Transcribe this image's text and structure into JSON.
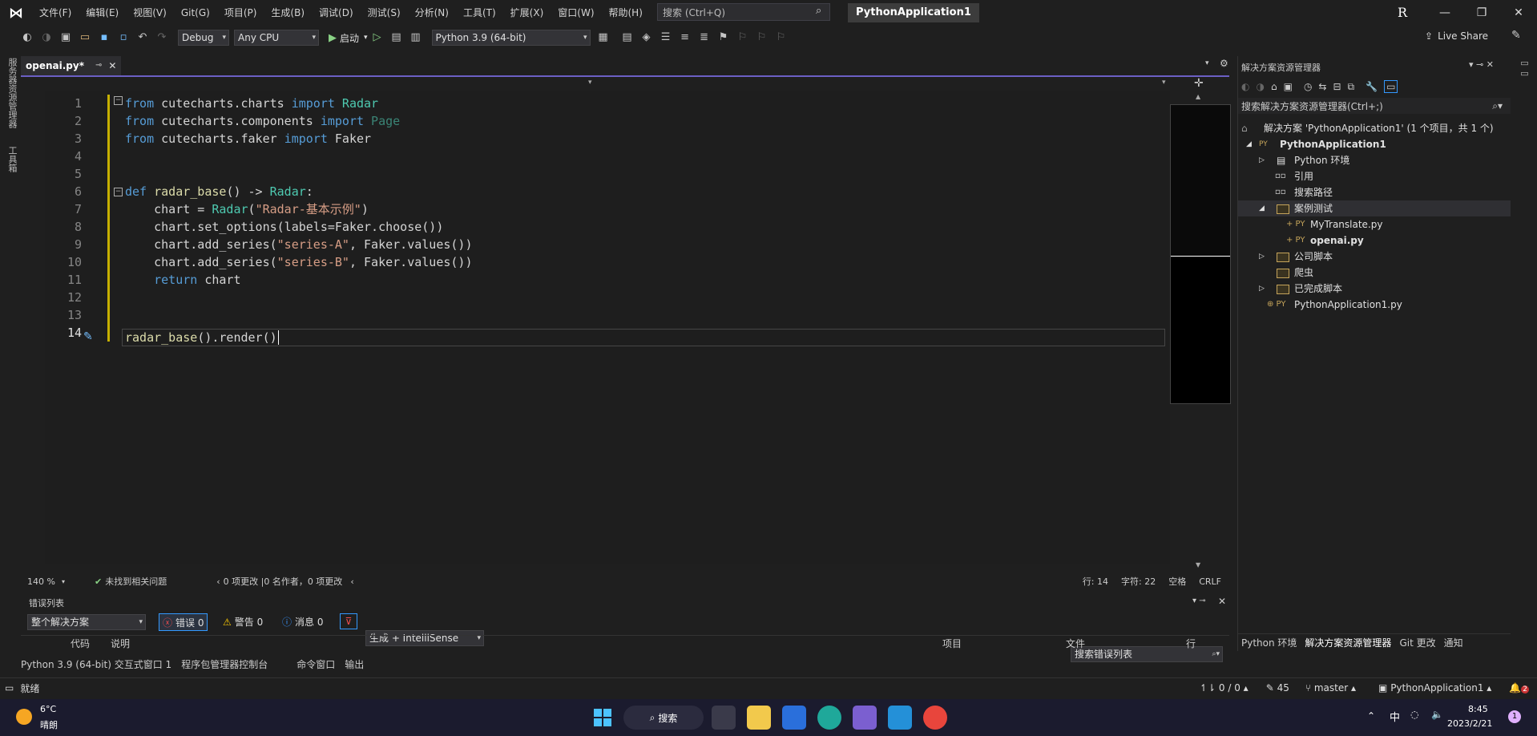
{
  "menu": {
    "items": [
      "文件(F)",
      "编辑(E)",
      "视图(V)",
      "Git(G)",
      "项目(P)",
      "生成(B)",
      "调试(D)",
      "测试(S)",
      "分析(N)",
      "工具(T)",
      "扩展(X)",
      "窗口(W)",
      "帮助(H)"
    ],
    "search_placeholder": "搜索 (Ctrl+Q)",
    "project_name": "PythonApplication1",
    "user_initial": "R"
  },
  "toolbar": {
    "config": "Debug",
    "platform": "Any CPU",
    "start_label": "启动",
    "python_env": "Python 3.9 (64-bit)",
    "live_share": "Live Share"
  },
  "left_strip": {
    "item1": "服务器资源管理器",
    "item2": "工具箱"
  },
  "editor": {
    "tab_label": "openai.py*",
    "zoom": "140 %",
    "issues": "未找到相关问题",
    "changes": "0 项更改 |0 名作者，0 项更改",
    "line": "行: 14",
    "col": "字符: 22",
    "whitespace": "空格",
    "eol": "CRLF",
    "line_numbers": [
      "1",
      "2",
      "3",
      "4",
      "5",
      "6",
      "7",
      "8",
      "9",
      "10",
      "11",
      "12",
      "13",
      "14"
    ]
  },
  "code": {
    "l1a": "from",
    "l1b": " cutecharts.charts ",
    "l1c": "import",
    "l1d": " Radar",
    "l2a": "from",
    "l2b": " cutecharts.components ",
    "l2c": "import",
    "l2d": " Page",
    "l3a": "from",
    "l3b": " cutecharts.faker ",
    "l3c": "import",
    "l3d": " Faker",
    "l6a": "def",
    "l6b": " radar_base",
    "l6c": "() -> ",
    "l6d": "Radar",
    ":": ":",
    "l7a": "    chart = ",
    "l7b": "Radar",
    "l7c": "(",
    "l7d": "\"Radar-基本示例\"",
    "l7e": ")",
    "l8": "    chart.set_options(labels=Faker.choose())",
    "l9a": "    chart.add_series(",
    "l9b": "\"series-A\"",
    "l9c": ", Faker.values())",
    "l10a": "    chart.add_series(",
    "l10b": "\"series-B\"",
    "l10c": ", Faker.values())",
    "l11a": "    return",
    "l11b": " chart",
    "l14a": "radar_base",
    "l14b": "().render()"
  },
  "error_list": {
    "title": "错误列表",
    "scope": "整个解决方案",
    "errors": "错误 0",
    "warnings": "警告 0",
    "messages": "消息 0",
    "build_filter": "生成 + IntelliSense",
    "search_placeholder": "搜索错误列表",
    "col_code": "代码",
    "col_desc": "说明",
    "col_project": "项目",
    "col_file": "文件",
    "col_line": "行"
  },
  "bottom_tabs": [
    "Python 3.9 (64-bit) 交互式窗口 1",
    "程序包管理器控制台",
    "命令窗口",
    "输出"
  ],
  "solution": {
    "title": "解决方案资源管理器",
    "search_placeholder": "搜索解决方案资源管理器(Ctrl+;)",
    "root": "解决方案 'PythonApplication1' (1 个项目，共 1 个)",
    "project": "PythonApplication1",
    "env": "Python 环境",
    "refs": "引用",
    "search_paths": "搜索路径",
    "folder1": "案例测试",
    "file1": "MyTranslate.py",
    "file2": "openai.py",
    "folder2": "公司脚本",
    "folder3": "爬虫",
    "folder4": "已完成脚本",
    "main_file": "PythonApplication1.py",
    "tabs": [
      "Python 环境",
      "解决方案资源管理器",
      "Git 更改",
      "通知"
    ]
  },
  "status": {
    "ready": "就绪",
    "sync": "0 / 0",
    "edits": "45",
    "branch": "master",
    "repo": "PythonApplication1",
    "notif": "2"
  },
  "taskbar": {
    "temp": "6°C",
    "weather": "晴朗",
    "search": "搜索",
    "ime": "中",
    "time": "8:45",
    "date": "2023/2/21",
    "badge": "1"
  },
  "colors": {
    "accent": "#6b5fc4",
    "keyword": "#569cd6",
    "class": "#4ec9b0",
    "string": "#d69d85"
  }
}
